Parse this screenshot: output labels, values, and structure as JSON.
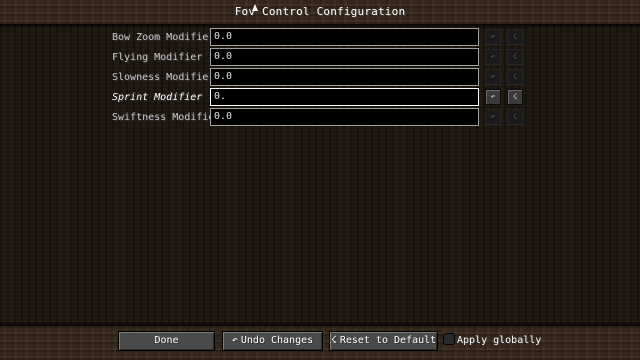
{
  "screen": {
    "title": "Fov Control Configuration"
  },
  "settings": [
    {
      "label": "Bow Zoom Modifier",
      "value": "0.0",
      "changed": false,
      "editing": false
    },
    {
      "label": "Flying Modifier",
      "value": "0.0",
      "changed": false,
      "editing": false
    },
    {
      "label": "Slowness Modifier",
      "value": "0.0",
      "changed": false,
      "editing": false
    },
    {
      "label": "Sprint Modifier",
      "value": "0.",
      "changed": true,
      "editing": true
    },
    {
      "label": "Swiftness Modifier",
      "value": "0.0",
      "changed": false,
      "editing": false
    }
  ],
  "row_buttons": {
    "undo_glyph": "↶",
    "reset_glyph": "☇"
  },
  "footer": {
    "done_label": "Done",
    "undo_label": "Undo Changes",
    "undo_icon": "↶",
    "reset_label": "Reset to Default",
    "reset_icon": "☇",
    "apply_globally_label": "Apply globally",
    "apply_globally_checked": false
  },
  "colors": {
    "background_dirt": "#3a2a1c",
    "list_background": "#1b140d",
    "field_background": "#000000",
    "field_border": "#a0a0a0",
    "text_white": "#ffffff",
    "label_gray": "#c8c8c8",
    "button_gray": "#4a4a4a"
  }
}
